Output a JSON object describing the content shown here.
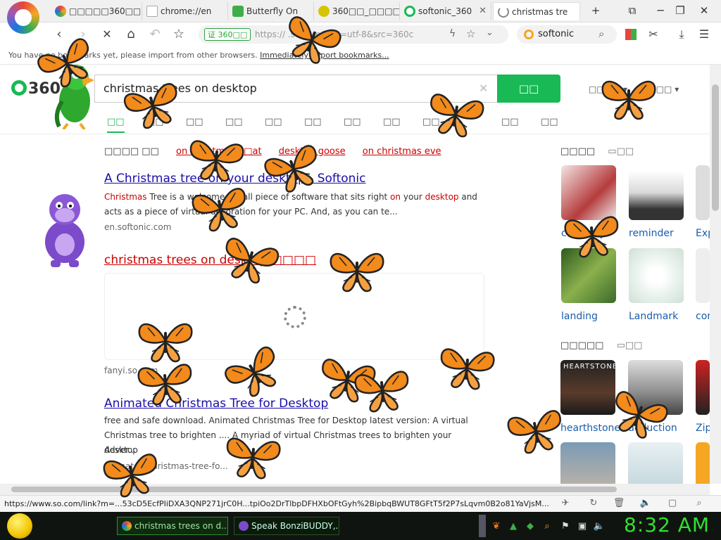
{
  "tabs": [
    {
      "label": "□□□□□360□□",
      "color": "#e8463a"
    },
    {
      "label": "chrome://en",
      "color": "#9aa0a6"
    },
    {
      "label": "Butterfly On",
      "color": "#3fae49"
    },
    {
      "label": "360□□_□□□□",
      "color": "#d6c400"
    },
    {
      "label": "softonic_360",
      "color": "#19b955"
    },
    {
      "label": "christmas tre",
      "color": "#19b955"
    }
  ],
  "nav": {
    "cert": "证 360□□",
    "url": "https:// .so.com/s?ie=utf-8&src=360c",
    "search_text": "softonic"
  },
  "bookmark_bar": {
    "text": "You have no bookmarks yet, please import from other browsers.",
    "import_link": "Immediately import bookmarks..."
  },
  "search": {
    "logo": "360",
    "query": "christmas trees on desktop",
    "button": "□□",
    "top_right_1": "□□□□ ▾",
    "top_right_2": "□□□□ ▾"
  },
  "vertical_tabs": [
    "□□",
    "□□",
    "□□",
    "□□",
    "□□",
    "□□",
    "□□",
    "□□",
    "□□",
    "□□",
    "□□"
  ],
  "related": {
    "label": "□□□□ □□",
    "links": [
      "on christmas□□at",
      "desktop goose",
      "on christmas eve"
    ]
  },
  "results": [
    {
      "title": "A Christmas tree on your desktop - Softonic",
      "desc_parts": [
        "Christmas",
        " Tree is a welcome, small piece of software that sits right ",
        "on",
        " your ",
        "desktop",
        " and acts as a piece of virtual decoration for your PC. And, as you can te..."
      ],
      "url": "en.softonic.com"
    },
    {
      "title": "christmas trees on desktop □□□□",
      "url": "fanyi.so.com"
    },
    {
      "title": "Animated Christmas Tree for Desktop",
      "desc_line1": "free and safe download. Animated Christmas Tree for Desktop latest version: A virtual",
      "desc_line2": "Christmas tree to brighten .... A myriad of virtual Christmas trees to brighten your desktop",
      "desc_line3": "Adver...",
      "url": "animated-christmas-tree-fo..."
    }
  ],
  "right": {
    "head1": "□□□□",
    "head1_extra": "□□",
    "thumbs1": [
      {
        "label": "currently"
      },
      {
        "label": "reminder"
      },
      {
        "label": "Exp"
      },
      {
        "label": "landing"
      },
      {
        "label": "Landmark"
      },
      {
        "label": "cor"
      }
    ],
    "head2": "□□□□□",
    "head2_extra": "□□",
    "thumbs2": [
      {
        "label": "hearthstone",
        "caption": "HEARTSTONE"
      },
      {
        "label": "deduction"
      },
      {
        "label": "Zipp"
      }
    ]
  },
  "status_url": "https://www.so.com/link?m=...53cD5EcfPIiDXA3QNP271jrC0H...tpiOo2DrTlbpDFHXbOFtGyh%2BipbqBWUT8GFtT5f2P7sLqvm0B2o81YaVjsM...",
  "taskbar": {
    "item1": "christmas trees on d...",
    "item2": "Speak BonziBUDDY,...",
    "clock": "8:32 AM"
  },
  "colors": {
    "brand": "#19b955",
    "link": "#1a0dab",
    "highlight": "#cc0000",
    "clock": "#2fe02f"
  }
}
